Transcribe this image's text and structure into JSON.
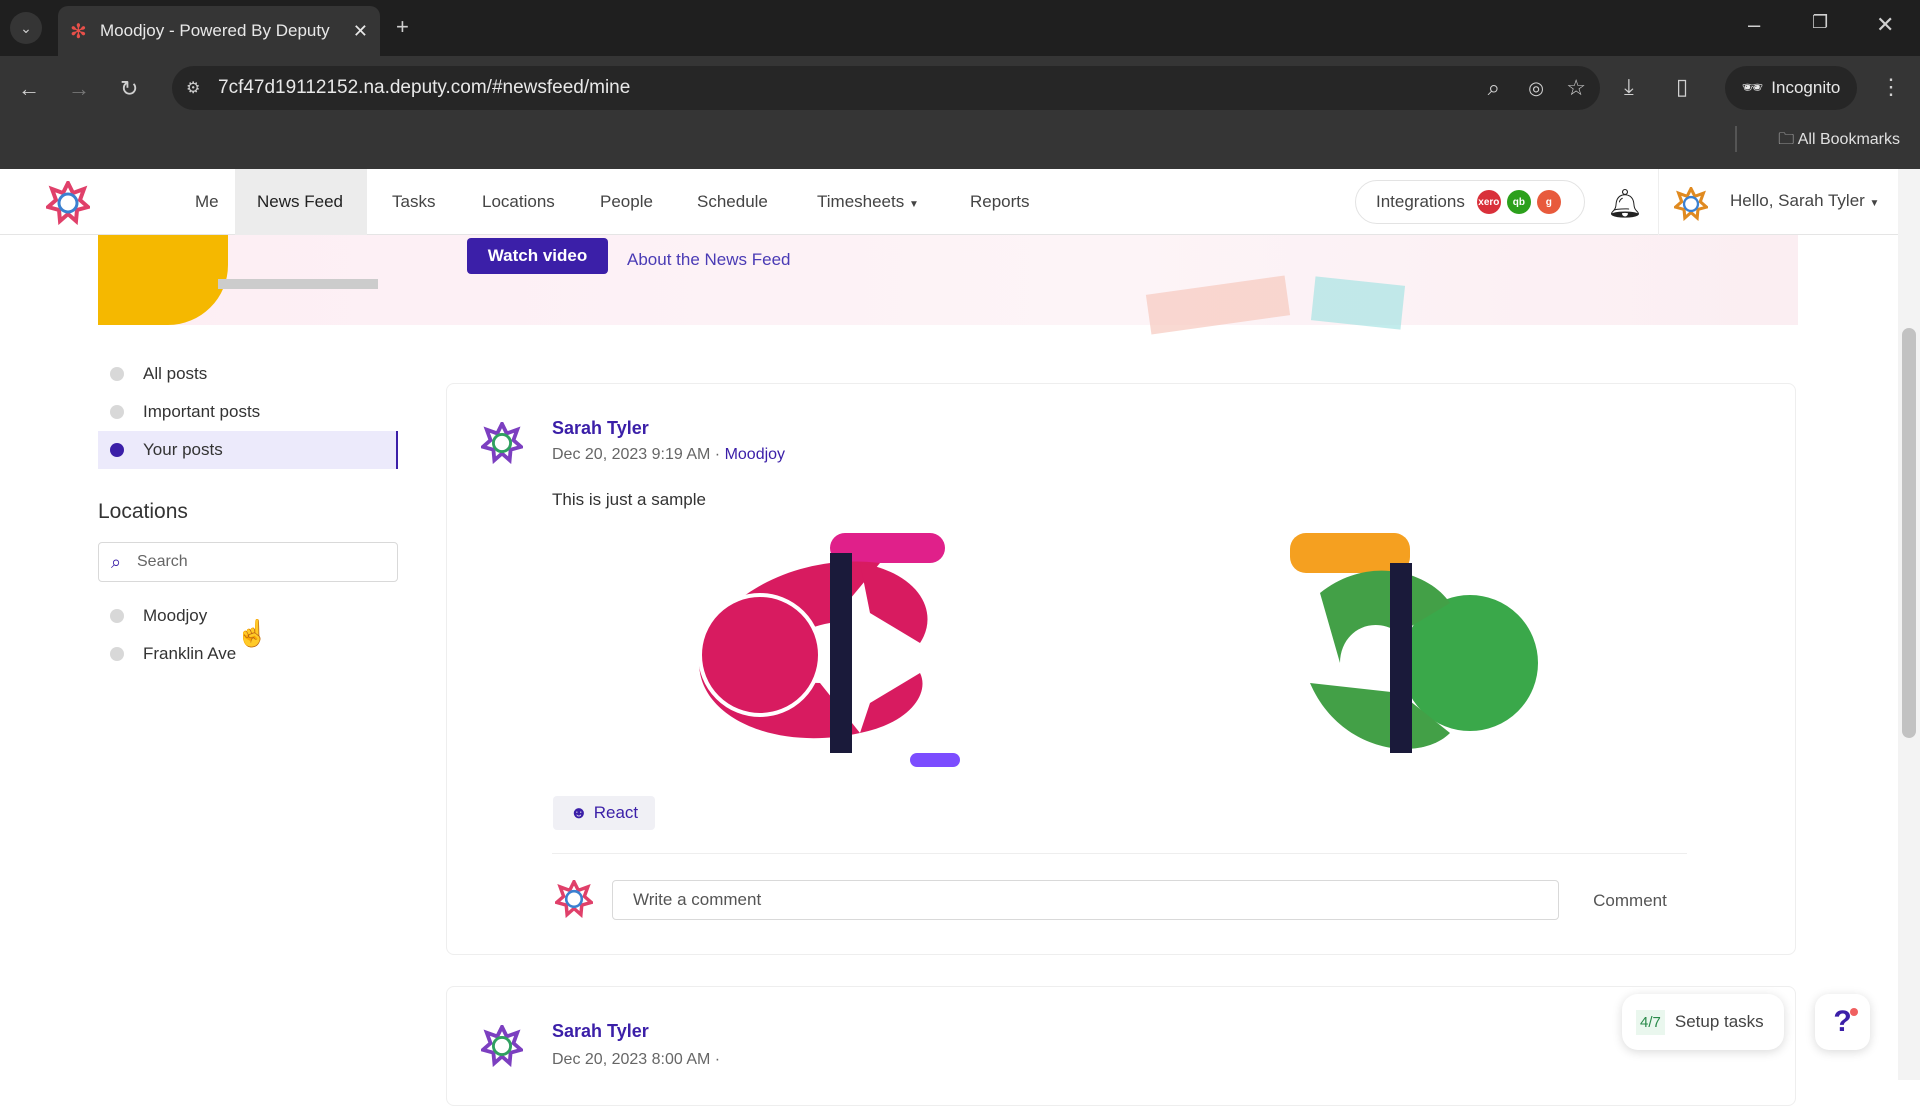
{
  "browser": {
    "tab_title": "Moodjoy - Powered By Deputy",
    "url": "7cf47d19112152.na.deputy.com/#newsfeed/mine",
    "incognito": "Incognito",
    "bookmarks": "All Bookmarks"
  },
  "nav": {
    "items": [
      "Me",
      "News Feed",
      "Tasks",
      "Locations",
      "People",
      "Schedule",
      "Timesheets",
      "Reports"
    ],
    "active": "News Feed",
    "integrations": "Integrations",
    "integration_badges": [
      "xero",
      "qb",
      "g"
    ],
    "greeting": "Hello, Sarah Tyler"
  },
  "banner": {
    "watch_video": "Watch video",
    "about": "About the News Feed"
  },
  "sidebar": {
    "filters": [
      "All posts",
      "Important posts",
      "Your posts"
    ],
    "active": "Your posts",
    "locations_heading": "Locations",
    "search_placeholder": "Search",
    "locations": [
      "Moodjoy",
      "Franklin Ave"
    ]
  },
  "posts": [
    {
      "author": "Sarah Tyler",
      "date": "Dec 20, 2023 9:19 AM ·",
      "location": "Moodjoy",
      "text": "This is just a sample",
      "react": "React",
      "comment_placeholder": "Write a comment",
      "comment_button": "Comment"
    },
    {
      "author": "Sarah Tyler",
      "date": "Dec 20, 2023 8:00 AM ·"
    }
  ],
  "setup": {
    "progress": "4/7",
    "label": "Setup tasks"
  },
  "help": "?",
  "colors": {
    "accent": "#3b1fa8"
  }
}
